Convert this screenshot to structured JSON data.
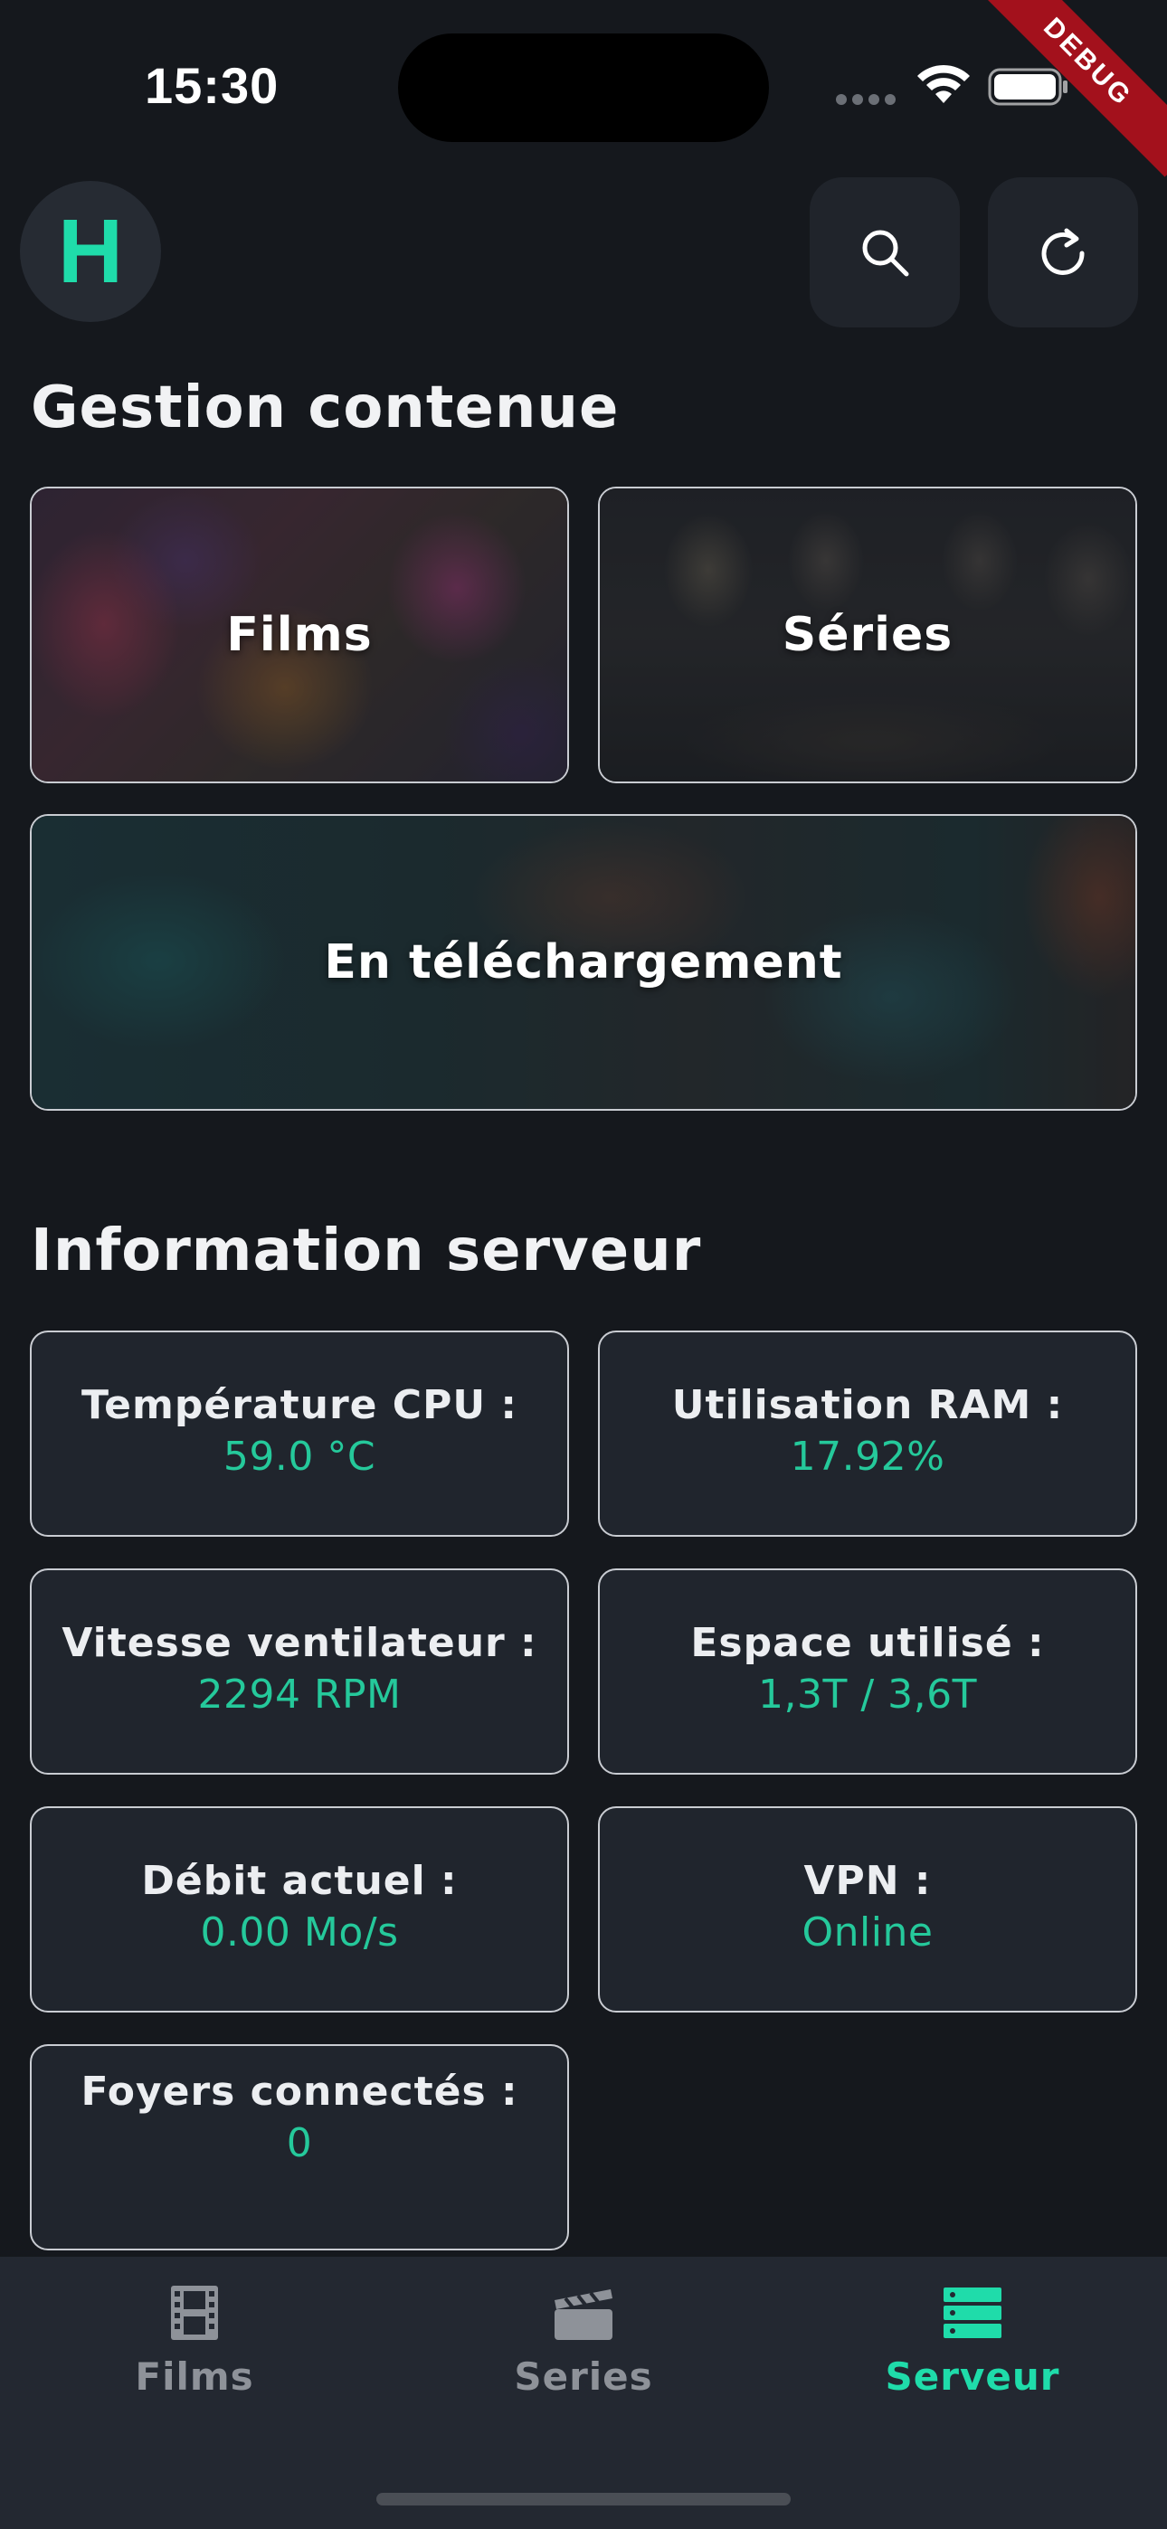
{
  "status_bar": {
    "time": "15:30",
    "icons": [
      "signal-dots-icon",
      "wifi-icon",
      "battery-icon"
    ]
  },
  "debug_banner": "DEBUG",
  "header": {
    "avatar_letter": "H",
    "actions": [
      "search-icon",
      "refresh-icon"
    ]
  },
  "content_section": {
    "title": "Gestion contenue",
    "cards": {
      "films": "Films",
      "series": "Séries",
      "downloads": "En téléchargement"
    }
  },
  "server_section": {
    "title": "Information serveur",
    "cpu": {
      "label": "Température CPU :",
      "value": "59.0 °C"
    },
    "ram": {
      "label": "Utilisation RAM :",
      "value": "17.92%"
    },
    "fan": {
      "label": "Vitesse ventilateur :",
      "value": "2294 RPM"
    },
    "disk": {
      "label": "Espace utilisé :",
      "value": "1,3T / 3,6T"
    },
    "throughput": {
      "label": "Débit actuel :",
      "value": "0.00 Mo/s"
    },
    "vpn": {
      "label": "VPN :",
      "value": "Online"
    },
    "homes": {
      "label": "Foyers connectés :",
      "value": "0"
    }
  },
  "bottom_nav": {
    "films": "Films",
    "series": "Series",
    "server": "Serveur",
    "active": "server"
  },
  "colors": {
    "accent": "#1fdcaa",
    "value_text": "#25c99b",
    "background": "#15181d",
    "card_background": "#20252d",
    "debug_ribbon": "#a3111c"
  }
}
